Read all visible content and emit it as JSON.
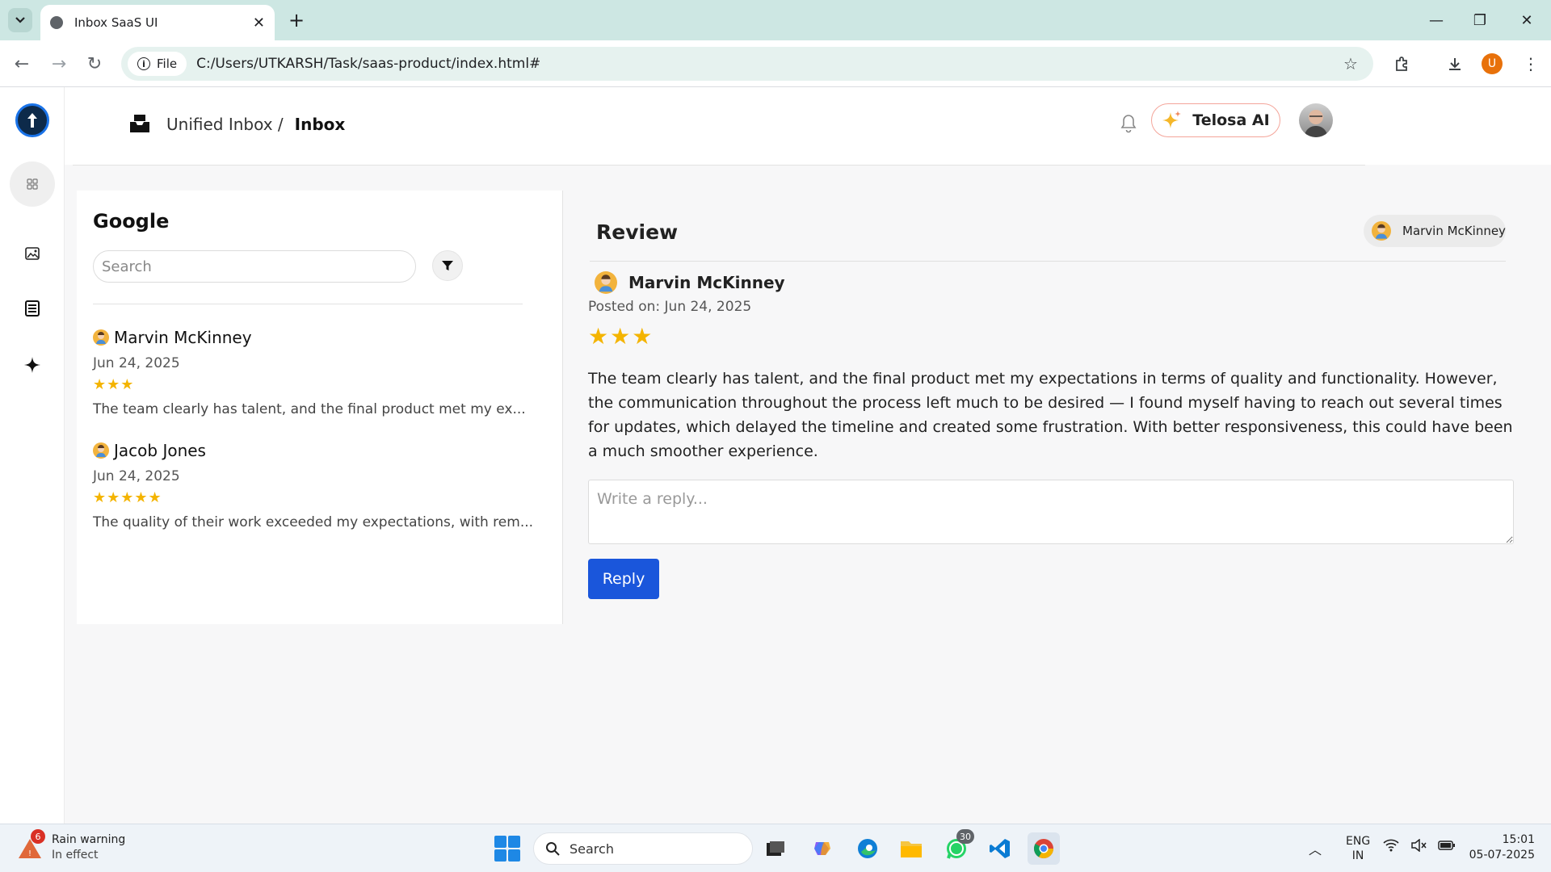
{
  "browser": {
    "tab_title": "Inbox SaaS UI",
    "file_chip": "File",
    "url": "C:/Users/UTKARSH/Task/saas-product/index.html#",
    "profile_initial": "U"
  },
  "app": {
    "breadcrumb": {
      "parent": "Unified Inbox /",
      "current": "Inbox"
    },
    "ai_button": "Telosa AI",
    "sidebar": {
      "icons": [
        "grid-icon",
        "image-icon",
        "document-icon",
        "sparkle-icon"
      ]
    },
    "list": {
      "title": "Google",
      "search_placeholder": "Search",
      "items": [
        {
          "name": "Marvin McKinney",
          "date": "Jun 24, 2025",
          "stars": "★★★",
          "excerpt": "The team clearly has talent, and the final product met my ex..."
        },
        {
          "name": "Jacob Jones",
          "date": "Jun 24, 2025",
          "stars": "★★★★★",
          "excerpt": "The quality of their work exceeded my expectations, with rem..."
        }
      ]
    },
    "review": {
      "title": "Review",
      "chip_name": "Marvin McKinney",
      "reviewer": "Marvin McKinney",
      "posted": "Posted on: Jun 24, 2025",
      "stars": "★★★",
      "body": "The team clearly has talent, and the final product met my expectations in terms of quality and functionality. However, the communication throughout the process left much to be desired — I found myself having to reach out several times for updates, which delayed the timeline and created some frustration. With better responsiveness, this could have been a much smoother experience.",
      "reply_placeholder": "Write a reply...",
      "reply_button": "Reply"
    }
  },
  "taskbar": {
    "weather_title": "Rain warning",
    "weather_sub": "In effect",
    "weather_badge": "6",
    "search_label": "Search",
    "whatsapp_badge": "30",
    "lang_line1": "ENG",
    "lang_line2": "IN",
    "time": "15:01",
    "date": "05-07-2025"
  },
  "colors": {
    "accent": "#1a56db",
    "star": "#f4b400",
    "chrome_bg": "#cde7e3"
  }
}
